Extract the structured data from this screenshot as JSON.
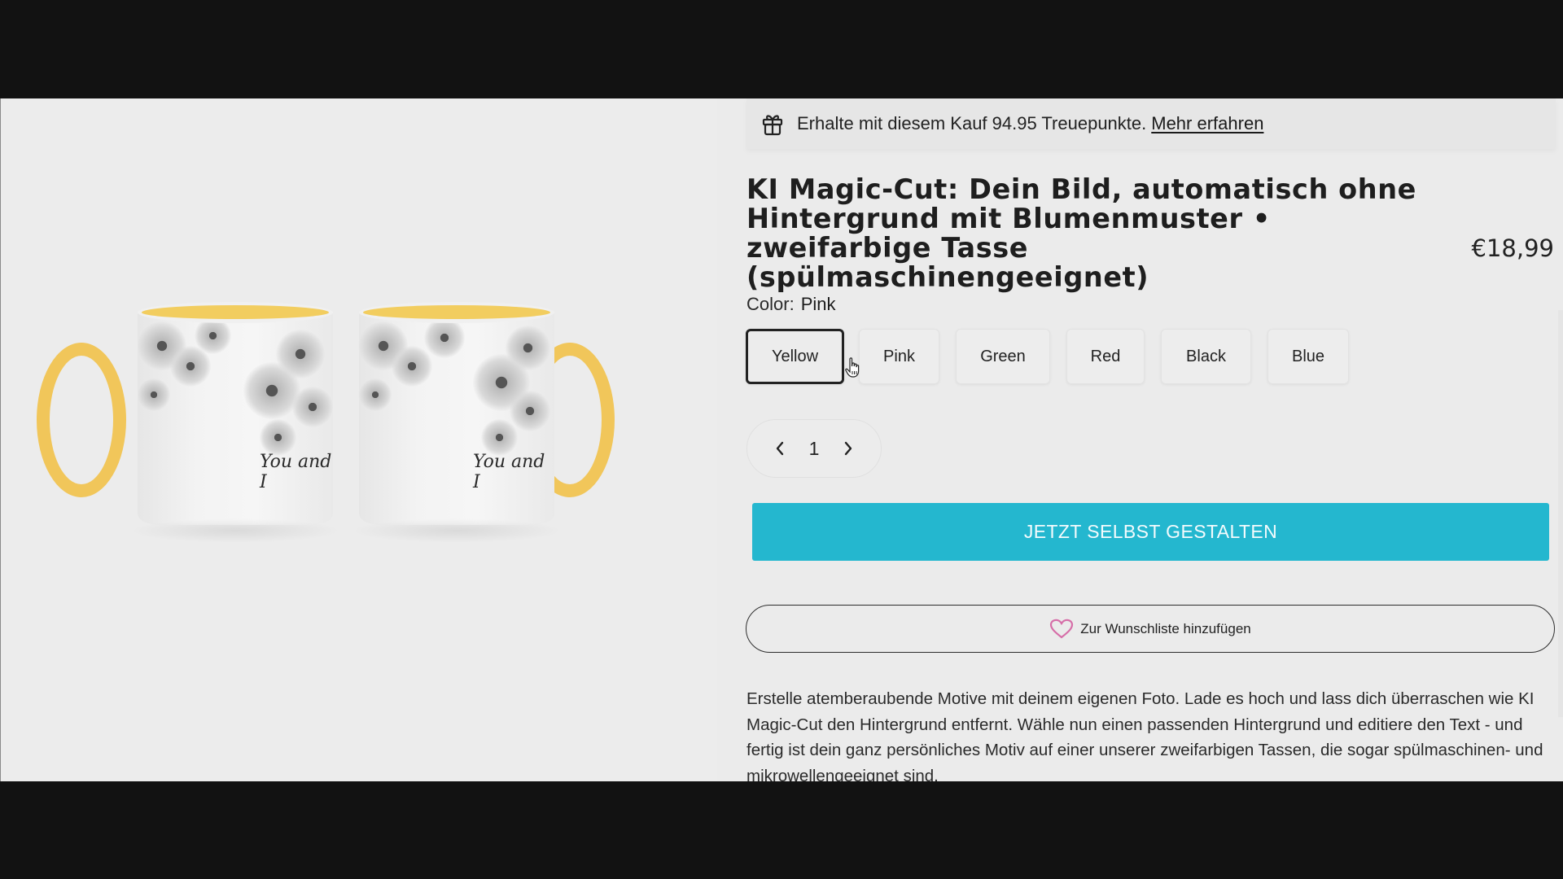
{
  "loyalty": {
    "text": "Erhalte mit diesem Kauf 94.95 Treuepunkte.",
    "link": "Mehr erfahren",
    "icon": "gift-icon"
  },
  "product": {
    "title": "KI Magic-Cut: Dein Bild, automatisch ohne Hintergrund mit Blumenmuster • zweifarbige Tasse (spülmaschinengeeignet)",
    "price": "€18,99",
    "image": {
      "description": "Two white mugs with yellow handle and rim, grey floral pattern",
      "mug_text": "You and I",
      "accent_color": "#f1c65a"
    }
  },
  "color": {
    "label": "Color:",
    "selected_value": "Pink",
    "options": [
      {
        "label": "Yellow",
        "selected": true
      },
      {
        "label": "Pink",
        "selected": false
      },
      {
        "label": "Green",
        "selected": false
      },
      {
        "label": "Red",
        "selected": false
      },
      {
        "label": "Black",
        "selected": false
      },
      {
        "label": "Blue",
        "selected": false
      }
    ]
  },
  "quantity": {
    "value": "1",
    "decrement_icon": "chevron-left-icon",
    "increment_icon": "chevron-right-icon"
  },
  "actions": {
    "cta_label": "JETZT SELBST GESTALTEN",
    "cta_color": "#24b7cf",
    "wishlist_label": "Zur Wunschliste hinzufügen",
    "wishlist_icon_color": "#d66ea8"
  },
  "description": "Erstelle atemberaubende Motive mit deinem eigenen Foto. Lade es hoch und lass dich überraschen wie KI Magic-Cut den Hintergrund entfernt. Wähle nun einen passenden Hintergrund und editiere den Text - und fertig ist dein ganz persönliches Motiv auf einer unserer zweifarbigen Tassen, die sogar spülmaschinen- und mikrowellengeeignet sind."
}
